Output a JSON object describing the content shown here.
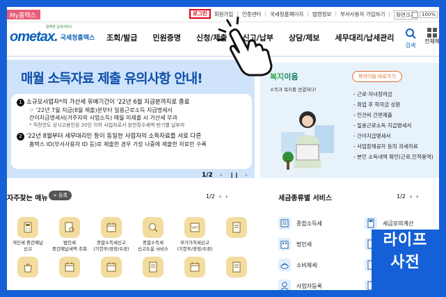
{
  "topbar": {
    "my_hometax": "My홈택스",
    "login": "로그인",
    "links": [
      "회원가입",
      "인증센터",
      "국세청홈페이지",
      "법령정보",
      "부서사용자 가입하기"
    ],
    "screen_size": "화면크기",
    "zoom_level": "100%"
  },
  "header": {
    "logo_tagline": "함께한 납세서비스",
    "logo_mark": "ometax.",
    "logo_name": "국세청홈택스",
    "nav": [
      "조회/발급",
      "민원증명",
      "신청/제출",
      "신고/납부",
      "상담/제보",
      "세무대리/납세관리"
    ],
    "search_label": "검색",
    "menu_label": "전체메뉴"
  },
  "banner": {
    "title": "매월 소득자료 제출 유의사항 안내!",
    "item1": "소규모사업자*의 가산세 유예기간이 '22년 6월 지급분까지로 종료",
    "item1_sub1": "'22년 7월 지급(8월 제출)분부터 일용근로소득 지급명세서",
    "item1_sub2": "간이지급명세서(거주자의 사업소득) 매월 미제출 시 가산세 부과",
    "item1_note": "* 직전연도 상시고용인원 20인 이하 사업자로서 원천징수세액 반기별 납부자",
    "item2_line1": "'22년 8월부터 세무대리인 등이 동일한 사업자의 소득자료를 서로 다른",
    "item2_line2": "홈택스 ID(부서사용자 ID 등)로 제출한 경우 가장 나중에 제출한 자료만 수록",
    "pager": "1/2",
    "num1": "1",
    "num2": "2"
  },
  "welfare": {
    "title_a": "복지",
    "title_b": "이음",
    "subtitle": "소득과 복지를 연결하다!",
    "button": "복지이음 바로가기",
    "items": [
      "근로·자녀장려금",
      "취업 후 학자금 상환",
      "인건비 간편제출",
      "일용근로소득 지급명세서",
      "간이지급명세서",
      "사업장제공자 등의 과세자료",
      "본인 소득내역 확인(근로,인적용역)"
    ]
  },
  "favorites": {
    "title": "자주찾는 메뉴",
    "register": "+ 등록",
    "pager": "1/2",
    "items": [
      {
        "l1": "개인세 중간예납",
        "l2": "신고",
        "icon": "calculator-icon"
      },
      {
        "l1": "법인세",
        "l2": "중간예납세액 조회",
        "icon": "document-search-icon"
      },
      {
        "l1": "종합소득세신고",
        "l2": "(기한후/경정/수정)",
        "icon": "calendar-icon"
      },
      {
        "l1": "종합소득세",
        "l2": "신고도움 서비스",
        "icon": "magnifier-icon"
      },
      {
        "l1": "부가가치세신고",
        "l2": "(기한후/경정/수정)",
        "icon": "vat-icon"
      },
      {
        "l1": "",
        "l2": "",
        "icon": "document-icon"
      },
      {
        "l1": "",
        "l2": "",
        "icon": "bag-icon"
      },
      {
        "l1": "",
        "l2": "",
        "icon": "calendar-icon"
      },
      {
        "l1": "",
        "l2": "",
        "icon": "calendar-icon"
      },
      {
        "l1": "",
        "l2": "",
        "icon": "document-icon"
      },
      {
        "l1": "",
        "l2": "",
        "icon": "calendar-icon"
      },
      {
        "l1": "",
        "l2": "",
        "icon": "document-icon"
      }
    ]
  },
  "tax_services": {
    "title": "세금종류별 서비스",
    "pager": "1/2",
    "items": [
      {
        "label": "종합소득세",
        "icon": "income-tax-icon"
      },
      {
        "label": "세금모의계산",
        "icon": "calculator-icon"
      },
      {
        "label": "법인세",
        "icon": "corporate-tax-icon"
      },
      {
        "label": "",
        "icon": "document-icon"
      },
      {
        "label": "소비제세",
        "icon": "consumption-tax-icon"
      },
      {
        "label": "",
        "icon": "document-icon"
      },
      {
        "label": "사업자등록",
        "icon": "business-registration-icon"
      },
      {
        "label": "",
        "icon": "document-icon"
      }
    ]
  },
  "badge": {
    "line1": "라이프",
    "line2": "사전"
  },
  "colors": {
    "frame": "#1560d6",
    "brand": "#0b5fb8",
    "banner_bg": "#cfe4fb",
    "welfare_bg": "#e8f2fb",
    "menu_icon_bg": "#f3dc9f",
    "login_highlight": "#e0001a"
  }
}
